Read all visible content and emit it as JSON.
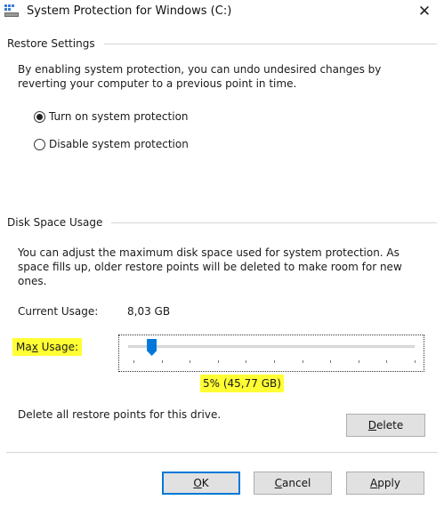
{
  "window": {
    "title": "System Protection for Windows (C:)",
    "close_glyph": "✕"
  },
  "restore_settings": {
    "header": "Restore Settings",
    "description_line1": "By enabling system protection, you can undo undesired changes by",
    "description_line2": "reverting your computer to a previous point in time.",
    "options": [
      {
        "label": "Turn on system protection",
        "selected": true
      },
      {
        "label": "Disable system protection",
        "selected": false
      }
    ]
  },
  "disk_space": {
    "header": "Disk Space Usage",
    "description_line1": "You can adjust the maximum disk space used for system protection. As",
    "description_line2": "space fills up, older restore points will be deleted to make room for new",
    "description_line3": "ones.",
    "current_usage_label": "Current Usage:",
    "current_usage_value": "8,03 GB",
    "max_usage_label_pre": "Ma",
    "max_usage_label_accel": "x",
    "max_usage_label_post": " Usage:",
    "max_usage_percent": 5,
    "max_usage_value": "5% (45,77 GB)",
    "delete_text": "Delete all restore points for this drive.",
    "highlight_color": "#ffff33",
    "slider_thumb_color": "#0078d7"
  },
  "buttons": {
    "delete": {
      "accel": "D",
      "rest": "elete"
    },
    "ok": {
      "accel": "O",
      "rest": "K"
    },
    "cancel": {
      "accel": "C",
      "rest": "ancel"
    },
    "apply": {
      "accel": "A",
      "rest": "pply"
    }
  },
  "icons": {
    "title_icon": "system-protection-drive-icon",
    "close": "close-icon"
  }
}
